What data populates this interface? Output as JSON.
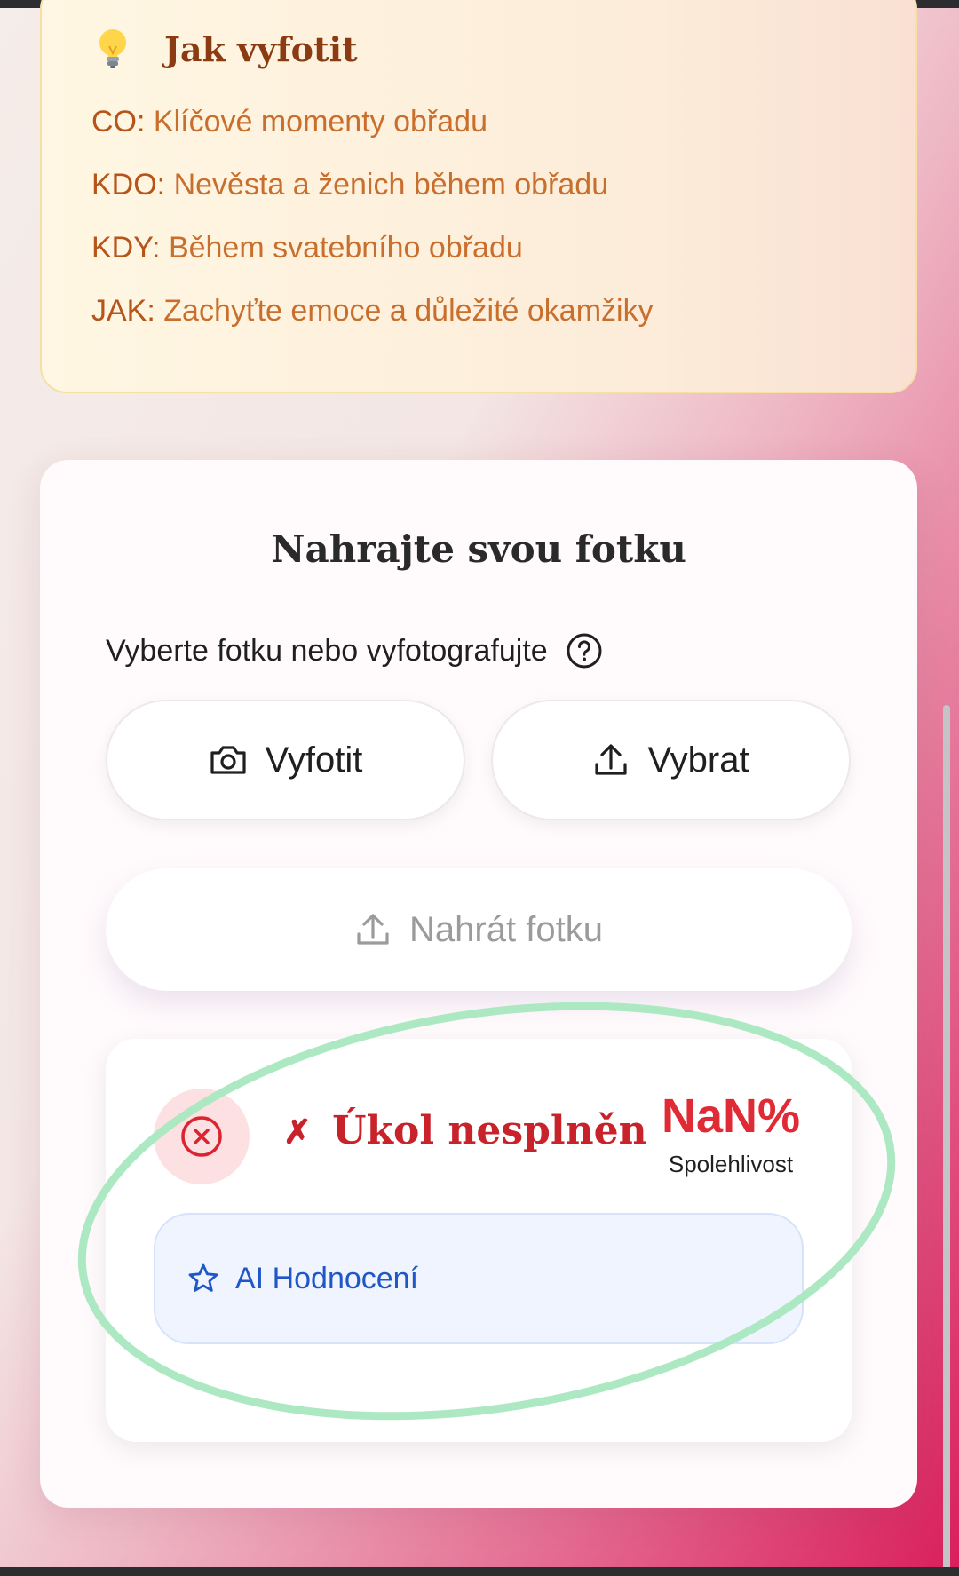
{
  "tip": {
    "icon": "lightbulb-icon",
    "title": "Jak vyfotit",
    "lines": [
      {
        "key": "CO:",
        "value": "Klíčové momenty obřadu"
      },
      {
        "key": "KDO:",
        "value": "Nevěsta a ženich během obřadu"
      },
      {
        "key": "KDY:",
        "value": "Během svatebního obřadu"
      },
      {
        "key": "JAK:",
        "value": "Zachyťte emoce a důležité okamžiky"
      }
    ]
  },
  "upload": {
    "title": "Nahrajte svou fotku",
    "subtitle": "Vyberte fotku nebo vyfotografujte",
    "take_photo_label": "Vyfotit",
    "pick_label": "Vybrat",
    "upload_label": "Nahrát fotku"
  },
  "result": {
    "status_mark": "✗",
    "status_text": "Úkol nesplněn",
    "confidence_value": "NaN%",
    "confidence_label": "Spolehlivost",
    "ai_label": "AI Hodnocení"
  },
  "colors": {
    "fail_red": "#c8232b",
    "ai_blue": "#2057c8",
    "highlight_green": "#a8e8c0"
  }
}
